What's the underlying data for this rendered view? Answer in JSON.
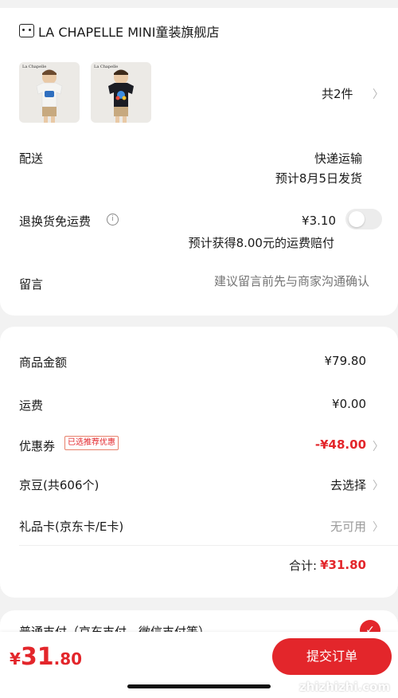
{
  "store": {
    "name": "LA CHAPELLE MINI童装旗舰店",
    "icon": "store-icon"
  },
  "products": {
    "count_label": "共2件",
    "thumbnails": [
      {
        "brand": "La Chapelle",
        "shirt_color": "#f4f4f2",
        "shorts_color": "#c7a97f"
      },
      {
        "brand": "La Chapelle",
        "shirt_color": "#1b1d24",
        "shorts_color": "#c7a97f"
      }
    ]
  },
  "delivery": {
    "label": "配送",
    "method": "快递运输",
    "estimate": "预计8月5日发货"
  },
  "return_insurance": {
    "label": "退换货免运费",
    "price": "¥3.10",
    "note_prefix": "预计获得",
    "note_amount": "8.00",
    "note_suffix": "元的运费赔付",
    "enabled": false
  },
  "message": {
    "label": "留言",
    "placeholder": "建议留言前先与商家沟通确认"
  },
  "summary": {
    "goods_label": "商品金额",
    "goods_value": "¥79.80",
    "shipping_label": "运费",
    "shipping_value": "¥0.00",
    "coupon_label": "优惠券",
    "coupon_badge": "已选推荐优惠",
    "coupon_value": "-¥48.00",
    "jingdou_label": "京豆(共606个)",
    "jingdou_value": "去选择",
    "giftcard_label": "礼品卡(京东卡/E卡)",
    "giftcard_value": "无可用",
    "total_label": "合计:",
    "total_value": "¥31.80"
  },
  "payment": {
    "label": "普通支付（京东支付、微信支付等）"
  },
  "bottom": {
    "currency": "¥",
    "price_int": "31",
    "price_dec": ".80",
    "submit_label": "提交订单",
    "watermark": "zhizhizhi.com"
  },
  "colors": {
    "accent": "#e3262b",
    "background": "#f2f2f2"
  }
}
